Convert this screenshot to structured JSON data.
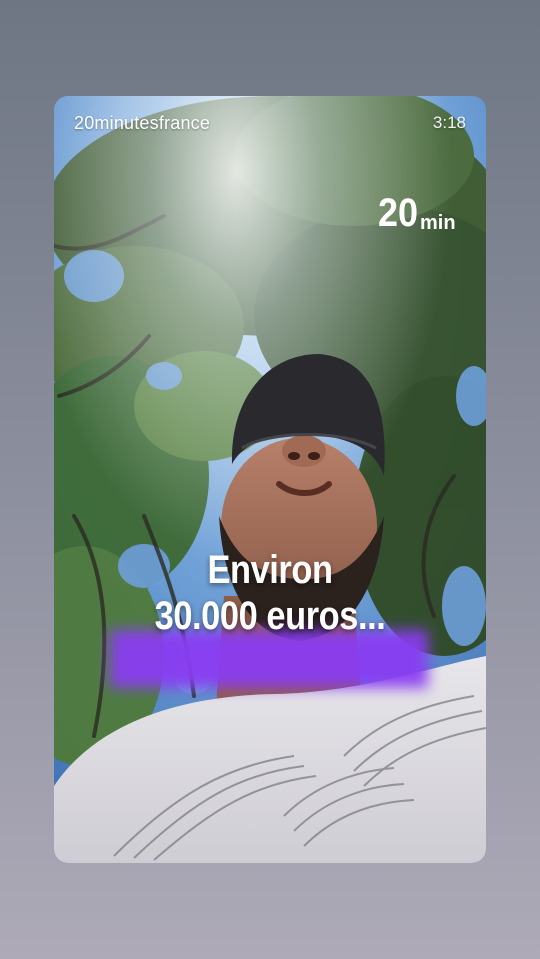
{
  "story": {
    "username": "20minutesfrance",
    "time": "3:18",
    "logo": {
      "text_main": "20",
      "text_sub": "min",
      "icon": "20min-logo-icon"
    },
    "caption": {
      "line1": "Environ",
      "line2": "30.000 euros..."
    }
  },
  "colors": {
    "highlight": "#8a3cf2",
    "background_top": "#6e7683",
    "background_bottom": "#aeaab8"
  }
}
